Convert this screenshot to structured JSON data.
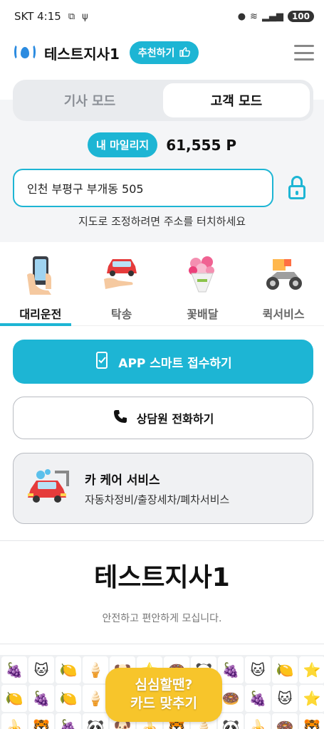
{
  "status_bar": {
    "carrier_time": "SKT 4:15",
    "battery": "100"
  },
  "header": {
    "title": "테스트지사1",
    "recommend_label": "추천하기"
  },
  "mode_toggle": {
    "driver_mode": "기사 모드",
    "customer_mode": "고객 모드",
    "selected": "고객 모드"
  },
  "mileage": {
    "label": "내 마일리지",
    "value": "61,555 P"
  },
  "address": {
    "value": "인천 부평구 부개동 505",
    "hint": "지도로 조정하려면 주소를 터치하세요"
  },
  "services": [
    {
      "label": "대리운전",
      "icon": "phone-hand-icon",
      "active": true
    },
    {
      "label": "탁송",
      "icon": "car-delivery-icon",
      "active": false
    },
    {
      "label": "꽃배달",
      "icon": "flower-bouquet-icon",
      "active": false
    },
    {
      "label": "퀵서비스",
      "icon": "scooter-icon",
      "active": false
    }
  ],
  "buttons": {
    "app_request": "APP 스마트 접수하기",
    "call_agent": "상담원 전화하기"
  },
  "car_care": {
    "title": "카 케어 서비스",
    "subtitle": "자동차정비/출장세차/폐차서비스"
  },
  "brand": {
    "name": "테스트지사1",
    "tagline": "안전하고 편안하게 모십니다."
  },
  "game_banner": {
    "line1": "심심할땐?",
    "line2": "카드 맞추기"
  },
  "colors": {
    "accent": "#1db5d4",
    "logo_blue": "#2b8be0",
    "game_yellow": "#f7c52b"
  }
}
